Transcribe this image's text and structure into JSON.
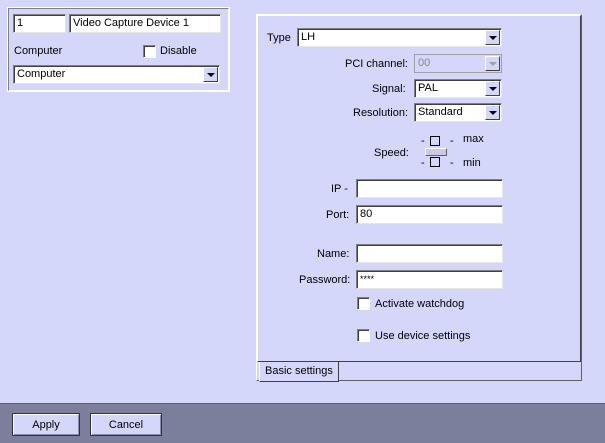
{
  "device": {
    "id": "1",
    "name": "Video Capture Device 1",
    "computer_label": "Computer",
    "disable_label": "Disable",
    "computer_value": "Computer"
  },
  "settings": {
    "type_label": "Type",
    "type_value": "LH",
    "pci_label": "PCI channel:",
    "pci_value": "00",
    "signal_label": "Signal:",
    "signal_value": "PAL",
    "resolution_label": "Resolution:",
    "resolution_value": "Standard",
    "speed_label": "Speed:",
    "speed_max": "max",
    "speed_min": "min",
    "ip_label": "IP -",
    "ip_value": "",
    "port_label": "Port:",
    "port_value": "80",
    "name_label": "Name:",
    "name_value": "",
    "password_label": "Password:",
    "password_value": "****",
    "watchdog_label": "Activate watchdog",
    "device_settings_label": "Use device settings"
  },
  "tabs": [
    {
      "label": "Basic settings"
    }
  ],
  "actions": {
    "apply_label": "Apply",
    "cancel_label": "Cancel"
  },
  "colors": {
    "background": "#d4d7fa",
    "bottom_bar": "#7c7f9c"
  }
}
